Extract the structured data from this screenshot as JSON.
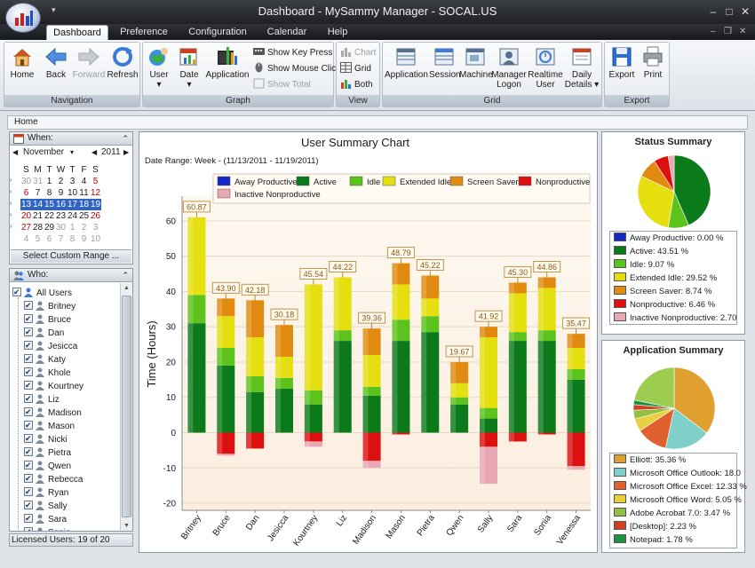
{
  "window": {
    "title": "Dashboard - MySammy Manager - SOCAL.US"
  },
  "tabs": [
    "Dashboard",
    "Preference",
    "Configuration",
    "Calendar",
    "Help"
  ],
  "ribbon": {
    "navigation": {
      "label": "Navigation",
      "home": "Home",
      "back": "Back",
      "forward": "Forward",
      "refresh": "Refresh"
    },
    "graph": {
      "label": "Graph",
      "user": "User",
      "date": "Date",
      "application": "Application",
      "show_key_press": "Show Key Press",
      "show_mouse_click": "Show Mouse Click",
      "show_total": "Show Total"
    },
    "view": {
      "label": "View",
      "chart": "Chart",
      "grid": "Grid",
      "both": "Both"
    },
    "grid": {
      "label": "Grid",
      "application": "Application",
      "session": "Session",
      "machine": "Machine",
      "manager_logon_1": "Manager",
      "manager_logon_2": "Logon",
      "realtime_user_1": "Realtime",
      "realtime_user_2": "User",
      "daily_details_1": "Daily",
      "daily_details_2": "Details"
    },
    "export": {
      "label": "Export",
      "export": "Export",
      "print": "Print"
    }
  },
  "breadcrumb": "Home",
  "when": {
    "title": "When:",
    "month": "November",
    "year": "2011",
    "weekdays": [
      "S",
      "M",
      "T",
      "W",
      "T",
      "F",
      "S"
    ],
    "weeks": [
      [
        "30",
        "31",
        "1",
        "2",
        "3",
        "4",
        "5"
      ],
      [
        "6",
        "7",
        "8",
        "9",
        "10",
        "11",
        "12"
      ],
      [
        "13",
        "14",
        "15",
        "16",
        "17",
        "18",
        "19"
      ],
      [
        "20",
        "21",
        "22",
        "23",
        "24",
        "25",
        "26"
      ],
      [
        "27",
        "28",
        "29",
        "30",
        "1",
        "2",
        "3"
      ],
      [
        "4",
        "5",
        "6",
        "7",
        "8",
        "9",
        "10"
      ]
    ],
    "selected_week": 2,
    "custom_range": "Select Custom Range ..."
  },
  "who": {
    "title": "Who:",
    "all_users": "All Users",
    "users": [
      "Britney",
      "Bruce",
      "Dan",
      "Jesicca",
      "Katy",
      "Khole",
      "Kourtney",
      "Liz",
      "Madison",
      "Mason",
      "Nicki",
      "Pietra",
      "Qwen",
      "Rebecca",
      "Ryan",
      "Sally",
      "Sara",
      "Sonia"
    ]
  },
  "status_bar": {
    "licensed": "Licensed Users: 19 of 20"
  },
  "chart_panel": {
    "title": "User Summary Chart",
    "date_range": "Date Range: Week - (11/13/2011 - 11/19/2011)"
  },
  "chart_data": {
    "type": "bar",
    "stacked": true,
    "title": "User Summary Chart",
    "ylabel": "Time (Hours)",
    "ylim": [
      -22,
      67
    ],
    "yticks": [
      -20,
      -10,
      0,
      10,
      20,
      30,
      40,
      50,
      60
    ],
    "categories": [
      "Britney",
      "Bruce",
      "Dan",
      "Jesicca",
      "Kourtney",
      "Liz",
      "Madison",
      "Mason",
      "Pietra",
      "Qwen",
      "Sally",
      "Sara",
      "Sonia",
      "Venessa"
    ],
    "totals": [
      "60.87",
      "43.90",
      "42.18",
      "30.18",
      "45.54",
      "44.22",
      "39.36",
      "48.79",
      "45.22",
      "19.67",
      "41.92",
      "45.30",
      "44.86",
      "35.47"
    ],
    "series": [
      {
        "name": "Away Productive",
        "color": "#1428c8",
        "values": [
          0,
          0,
          0,
          0,
          0,
          0,
          0,
          0,
          0,
          0,
          0,
          0,
          0,
          0
        ]
      },
      {
        "name": "Active",
        "color": "#0b7a1a",
        "values": [
          31,
          19,
          11.5,
          12.5,
          8,
          26,
          10.5,
          26,
          28.5,
          8,
          4,
          26,
          26,
          15
        ]
      },
      {
        "name": "Idle",
        "color": "#5cc21c",
        "values": [
          8,
          5,
          4.5,
          3,
          4,
          3,
          2.5,
          6,
          4.5,
          2,
          3,
          2.5,
          3,
          3
        ]
      },
      {
        "name": "Extended Idle",
        "color": "#e5df0f",
        "values": [
          22,
          9,
          11,
          6,
          30,
          15,
          9,
          10,
          5,
          4,
          20,
          11,
          12,
          6
        ]
      },
      {
        "name": "Screen Saver",
        "color": "#e08a10",
        "values": [
          0,
          5,
          10.5,
          9,
          0,
          0,
          7.5,
          6,
          6.5,
          6,
          3,
          3,
          3,
          4
        ]
      },
      {
        "name": "Nonproductive",
        "color": "#dd1010",
        "values": [
          0,
          -6,
          -4.5,
          0,
          -2.5,
          0,
          -8,
          -0.5,
          0,
          0,
          -4,
          -2.5,
          -0.5,
          -9.5
        ]
      },
      {
        "name": "Inactive Nonproductive",
        "color": "#e8a8b4",
        "values": [
          0,
          -0.5,
          0,
          0,
          -1.5,
          0,
          -2,
          0,
          0,
          0,
          -10.5,
          0,
          0,
          -1
        ]
      }
    ]
  },
  "status_summary": {
    "title": "Status Summary",
    "items": [
      {
        "label": "Away Productive: 0.00 %",
        "value": 0,
        "color": "#1428c8"
      },
      {
        "label": "Active: 43.51 %",
        "value": 43.51,
        "color": "#0b7a1a"
      },
      {
        "label": "Idle: 9.07 %",
        "value": 9.07,
        "color": "#5cc21c"
      },
      {
        "label": "Extended Idle: 29.52 %",
        "value": 29.52,
        "color": "#e5df0f"
      },
      {
        "label": "Screen Saver: 8.74 %",
        "value": 8.74,
        "color": "#e08a10"
      },
      {
        "label": "Nonproductive: 6.46 %",
        "value": 6.46,
        "color": "#dd1010"
      },
      {
        "label": "Inactive Nonproductive: 2.70",
        "value": 2.7,
        "color": "#e8a8b4"
      }
    ]
  },
  "application_summary": {
    "title": "Application Summary",
    "items": [
      {
        "label": "Elliott: 35.36 %",
        "value": 35.36,
        "color": "#e0a030"
      },
      {
        "label": "Microsoft Office Outlook: 18.0",
        "value": 18.0,
        "color": "#7ed0c8"
      },
      {
        "label": "Microsoft Office Excel: 12.33 %",
        "value": 12.33,
        "color": "#e06030"
      },
      {
        "label": "Microsoft Office Word: 5.05 %",
        "value": 5.05,
        "color": "#e8d040"
      },
      {
        "label": "Adobe Acrobat 7.0: 3.47 %",
        "value": 3.47,
        "color": "#90c040"
      },
      {
        "label": "[Desktop]: 2.23 %",
        "value": 2.23,
        "color": "#d04020"
      },
      {
        "label": "Notepad: 1.78 %",
        "value": 1.78,
        "color": "#209040"
      }
    ],
    "rest_value": 21.78,
    "rest_color": "#9ccc50"
  }
}
